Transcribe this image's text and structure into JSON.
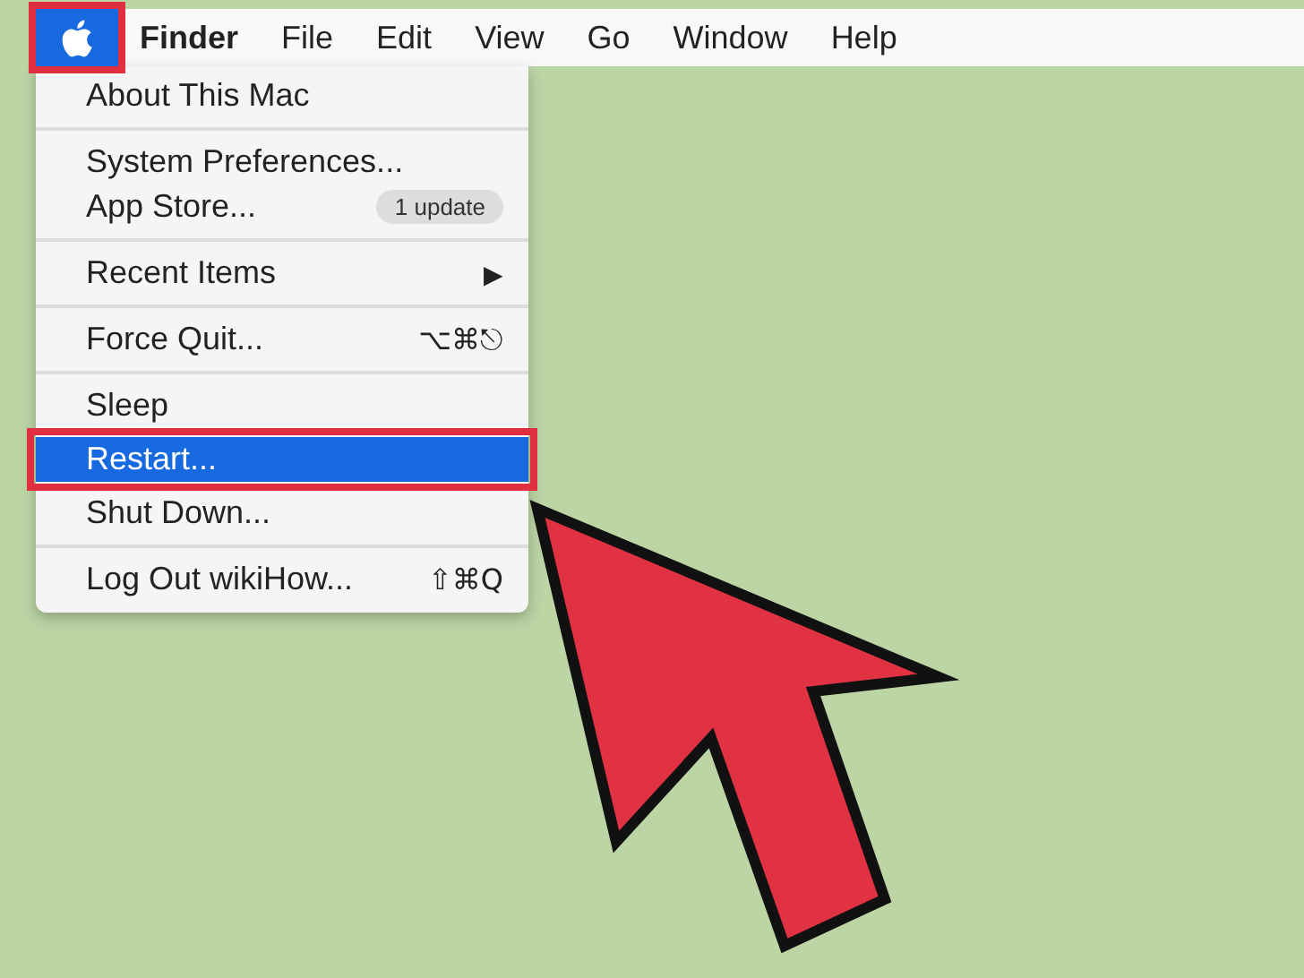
{
  "menu_bar": [
    {
      "kind": "apple",
      "selected": true,
      "annotated": true
    },
    {
      "kind": "text",
      "label": "Finder",
      "selected": false,
      "bold": true
    },
    {
      "kind": "text",
      "label": "File",
      "selected": false
    },
    {
      "kind": "text",
      "label": "Edit",
      "selected": false
    },
    {
      "kind": "text",
      "label": "View",
      "selected": false
    },
    {
      "kind": "text",
      "label": "Go",
      "selected": false
    },
    {
      "kind": "text",
      "label": "Window",
      "selected": false
    },
    {
      "kind": "text",
      "label": "Help",
      "selected": false
    }
  ],
  "apple_menu": [
    {
      "items": [
        {
          "label": "About This Mac",
          "selected": false
        }
      ]
    },
    {
      "items": [
        {
          "label": "System Preferences...",
          "selected": false
        },
        {
          "label": "App Store...",
          "badge": "1 update",
          "selected": false
        }
      ]
    },
    {
      "items": [
        {
          "label": "Recent Items",
          "submenu": "▶",
          "selected": false
        }
      ]
    },
    {
      "items": [
        {
          "label": "Force Quit...",
          "shortcut": "⌥⌘⎋",
          "selected": false
        }
      ]
    },
    {
      "items": [
        {
          "label": "Sleep",
          "selected": false
        },
        {
          "label": "Restart...",
          "selected": true,
          "annotated": true
        },
        {
          "label": "Shut Down...",
          "selected": false
        }
      ]
    },
    {
      "items": [
        {
          "label": "Log Out wikiHow...",
          "shortcut": "⇧⌘Q",
          "selected": false
        }
      ]
    }
  ]
}
